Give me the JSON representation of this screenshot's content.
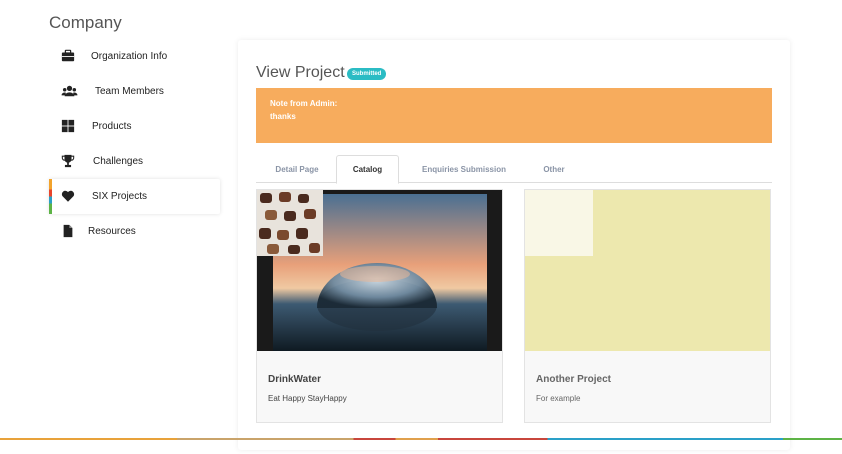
{
  "company_title": "Company",
  "sidebar": {
    "items": [
      {
        "label": "Organization Info",
        "icon": "briefcase-icon"
      },
      {
        "label": "Team Members",
        "icon": "users-icon"
      },
      {
        "label": "Products",
        "icon": "grid-icon"
      },
      {
        "label": "Challenges",
        "icon": "trophy-icon"
      },
      {
        "label": "SIX Projects",
        "icon": "heart-icon"
      },
      {
        "label": "Resources",
        "icon": "file-icon"
      }
    ]
  },
  "main": {
    "title": "View Project",
    "status_badge": "Submitted",
    "note": {
      "heading": "Note from Admin:",
      "text": "thanks",
      "color": "#f7ac5d"
    },
    "tabs": [
      {
        "label": "Detail Page"
      },
      {
        "label": "Catalog"
      },
      {
        "label": "Enquiries Submission"
      },
      {
        "label": "Other"
      }
    ],
    "active_tab": "Catalog",
    "projects": [
      {
        "name": "DrinkWater",
        "description": "Eat Happy StayHappy"
      },
      {
        "name": "Another Project",
        "description": "For example"
      }
    ]
  },
  "colors": {
    "badge": "#2bbcc4",
    "placeholder_image": "#ede8ae"
  }
}
